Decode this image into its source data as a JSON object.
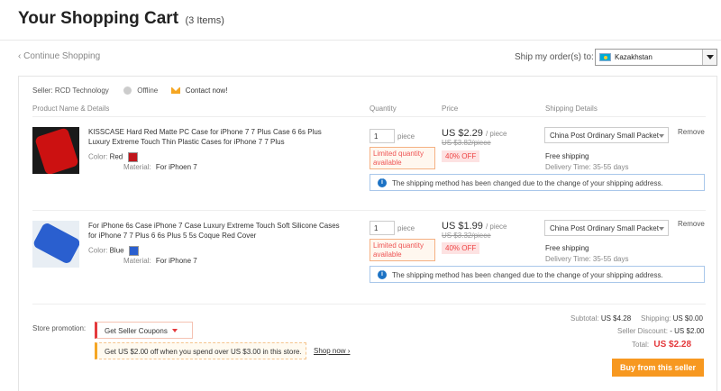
{
  "header": {
    "title": "Your Shopping Cart",
    "item_count": "(3 Items)"
  },
  "nav": {
    "continue_label": "‹ Continue Shopping",
    "ship_to_label": "Ship my order(s) to:",
    "country": "Kazakhstan"
  },
  "store": {
    "seller_label": "Seller:",
    "seller_name": "RCD Technology",
    "status": "Offline",
    "contact_label": "Contact now!"
  },
  "columns": {
    "product": "Product Name & Details",
    "quantity": "Quantity",
    "price": "Price",
    "shipping": "Shipping Details"
  },
  "items": [
    {
      "name": "KISSCASE Hard Red Matte PC Case for iPhone 7 7 Plus Case 6 6s Plus Luxury Extreme Touch Thin Plastic Cases for iPhone 7 7 Plus",
      "color_label": "Color:",
      "color": "Red",
      "swatch_color": "#c0151b",
      "material_label": "Material:",
      "material": "For iPhoen 7",
      "quantity": "1",
      "unit": "piece",
      "limited": "Limited quantity available",
      "price": "US $2.29",
      "per": "/ piece",
      "old_price": "US $3.82/piece",
      "discount": "40% OFF",
      "shipping_method": "China Post Ordinary Small Packet",
      "shipping_cost": "Free shipping",
      "delivery_time": "Delivery Time: 35-55 days",
      "remove": "Remove",
      "notice": "The shipping method has been changed due to the change of your shipping address."
    },
    {
      "name": "For iPhone 6s Case iPhone 7 Case Luxury Extreme Touch Soft Silicone Cases for iPhone 7 7 Plus 6 6s Plus 5 5s Coque Red Cover",
      "color_label": "Color:",
      "color": "Blue",
      "swatch_color": "#2a5fcf",
      "material_label": "Material:",
      "material": "For iPhone 7",
      "quantity": "1",
      "unit": "piece",
      "limited": "Limited quantity available",
      "price": "US $1.99",
      "per": "/ piece",
      "old_price": "US $3.32/piece",
      "discount": "40% OFF",
      "shipping_method": "China Post Ordinary Small Packet",
      "shipping_cost": "Free shipping",
      "delivery_time": "Delivery Time: 35-55 days",
      "remove": "Remove",
      "notice": "The shipping method has been changed due to the change of your shipping address."
    }
  ],
  "promotion": {
    "label": "Store promotion:",
    "coupon_button": "Get Seller Coupons",
    "offer": "Get US $2.00 off when you spend over US $3.00 in this store.",
    "shop_now": "Shop now ›"
  },
  "summary": {
    "subtotal_label": "Subtotal:",
    "subtotal": "US $4.28",
    "shipping_label": "Shipping:",
    "shipping": "US $0.00",
    "discount_label": "Seller Discount:",
    "discount": "- US $2.00",
    "total_label": "Total:",
    "total": "US $2.28",
    "buy_button": "Buy from this seller"
  }
}
